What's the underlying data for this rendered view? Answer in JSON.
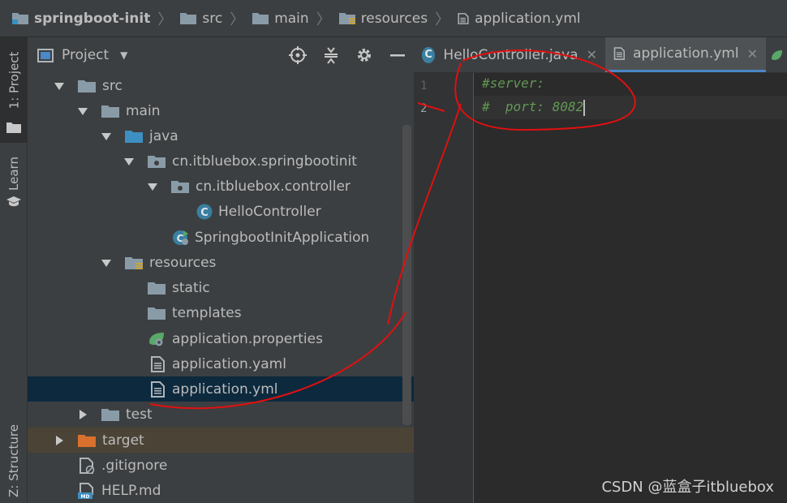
{
  "breadcrumb": {
    "items": [
      "springboot-init",
      "src",
      "main",
      "resources",
      "application.yml"
    ]
  },
  "left_stripe": {
    "project_tab": "1: Project",
    "learn_tab": "Learn",
    "structure_tab": "Z: Structure"
  },
  "project_panel": {
    "title": "Project",
    "tree": [
      {
        "label": "src",
        "icon": "folder-icon"
      },
      {
        "label": "main",
        "icon": "folder-icon"
      },
      {
        "label": "java",
        "icon": "source-folder-icon"
      },
      {
        "label": "cn.itbluebox.springbootinit",
        "icon": "package-icon"
      },
      {
        "label": "cn.itbluebox.controller",
        "icon": "package-icon"
      },
      {
        "label": "HelloController",
        "icon": "class-icon"
      },
      {
        "label": "SpringbootInitApplication",
        "icon": "spring-boot-class-icon"
      },
      {
        "label": "resources",
        "icon": "resources-folder-icon"
      },
      {
        "label": "static",
        "icon": "folder-icon"
      },
      {
        "label": "templates",
        "icon": "folder-icon"
      },
      {
        "label": "application.properties",
        "icon": "spring-properties-icon"
      },
      {
        "label": "application.yaml",
        "icon": "file-icon"
      },
      {
        "label": "application.yml",
        "icon": "file-icon"
      },
      {
        "label": "test",
        "icon": "folder-icon"
      },
      {
        "label": "target",
        "icon": "excluded-folder-icon"
      },
      {
        "label": ".gitignore",
        "icon": "ignore-file-icon"
      },
      {
        "label": "HELP.md",
        "icon": "markdown-file-icon"
      }
    ]
  },
  "editor": {
    "tabs": [
      {
        "label": "HelloController.java",
        "icon": "class-icon"
      },
      {
        "label": "application.yml",
        "icon": "file-icon",
        "active": true
      }
    ],
    "line_numbers": [
      "1",
      "2"
    ],
    "lines": [
      "#server:",
      "#  port: 8082"
    ]
  },
  "watermark": "CSDN @蓝盒子itbluebox",
  "colors": {
    "comment": "#629755",
    "selection": "#0d293e",
    "excluded": "#4b4336",
    "annotation": "#e01010"
  }
}
